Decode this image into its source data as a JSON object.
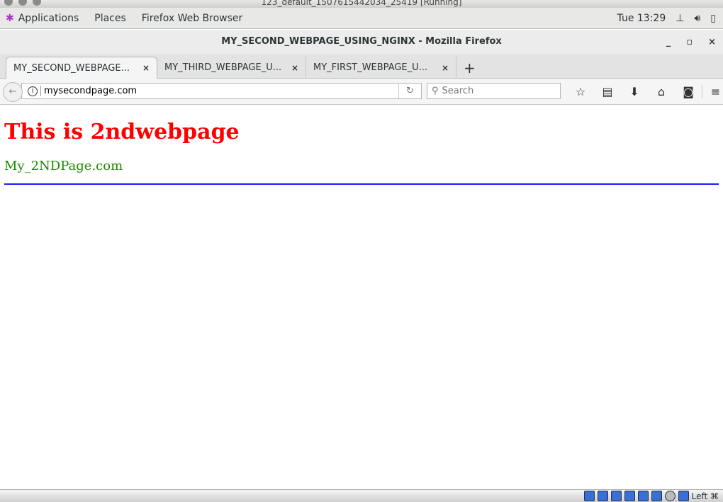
{
  "vm_title": "123_default_1507615442034_25419 [Running]",
  "topbar": {
    "applications": "Applications",
    "places": "Places",
    "app": "Firefox Web Browser",
    "clock": "Tue 13:29"
  },
  "window": {
    "title": "MY_SECOND_WEBPAGE_USING_NGINX - Mozilla Firefox",
    "minimize": "_",
    "maximize": "▫",
    "close": "×"
  },
  "tabs": [
    {
      "label": "MY_SECOND_WEBPAGE...",
      "active": true
    },
    {
      "label": "MY_THIRD_WEBPAGE_U..."
    },
    {
      "label": "MY_FIRST_WEBPAGE_U..."
    }
  ],
  "tab_close": "×",
  "new_tab": "+",
  "nav": {
    "url": "mysecondpage.com",
    "search_placeholder": "Search"
  },
  "page": {
    "heading": "This is 2ndwebpage",
    "subtext": "My_2NDPage.com"
  },
  "statusbar": {
    "host_key": "Left ⌘"
  }
}
